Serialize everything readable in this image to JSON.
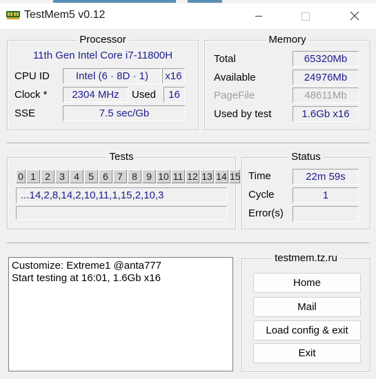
{
  "window": {
    "title": "TestMem5 v0.12",
    "controls": {
      "minimize": "minimize",
      "maximize": "maximize",
      "close": "close"
    }
  },
  "processor": {
    "title": "Processor",
    "model": "11th Gen Intel Core i7-11800H",
    "cpu_id_label": "CPU ID",
    "cpu_id_value": "Intel  (6 · 8D · 1)",
    "cpu_threads": "x16",
    "clock_label": "Clock *",
    "clock_value": "2304 MHz",
    "used_label": "Used",
    "used_value": "16",
    "sse_label": "SSE",
    "sse_value": "7.5 sec/Gb"
  },
  "memory": {
    "title": "Memory",
    "total_label": "Total",
    "total_value": "65320Mb",
    "available_label": "Available",
    "available_value": "24976Mb",
    "pagefile_label": "PageFile",
    "pagefile_value": "48611Mb",
    "used_by_test_label": "Used by test",
    "used_by_test_value": "1.6Gb x16"
  },
  "tests": {
    "title": "Tests",
    "cells": [
      "0",
      "1",
      "2",
      "3",
      "4",
      "5",
      "6",
      "7",
      "8",
      "9",
      "10",
      "11",
      "12",
      "13",
      "14",
      "15"
    ],
    "sequence": "...14,2,8,14,2,10,11,1,15,2,10,3",
    "progress": ""
  },
  "status": {
    "title": "Status",
    "time_label": "Time",
    "time_value": "22m 59s",
    "cycle_label": "Cycle",
    "cycle_value": "1",
    "errors_label": "Error(s)",
    "errors_value": ""
  },
  "log": {
    "lines": [
      "Customize: Extreme1 @anta777",
      "Start testing at 16:01, 1.6Gb x16"
    ]
  },
  "links": {
    "title": "testmem.tz.ru",
    "home": "Home",
    "mail": "Mail",
    "load_config": "Load config & exit",
    "exit": "Exit"
  },
  "colors": {
    "value_text": "#1c1c8c",
    "dim_text": "#a0a0a0",
    "background": "#f0f0f0",
    "titlebar": "#ffffff",
    "top_accent": "#5a8fb5"
  }
}
